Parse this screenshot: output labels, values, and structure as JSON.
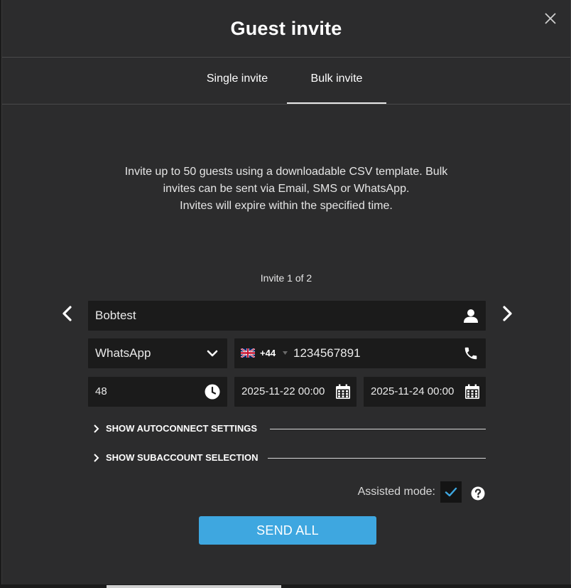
{
  "modal": {
    "title": "Guest invite",
    "close_icon": "close-icon"
  },
  "tabs": [
    {
      "label": "Single invite",
      "active": false
    },
    {
      "label": "Bulk invite",
      "active": true
    }
  ],
  "description": {
    "line1": "Invite up to 50 guests using a downloadable CSV template. Bulk",
    "line2": "invites can be sent via Email, SMS or WhatsApp.",
    "line3": "Invites will expire within the specified time."
  },
  "invite": {
    "counter": "Invite 1 of 2",
    "name": "Bobtest",
    "channel": "WhatsApp",
    "country_code": "+44",
    "phone": "1234567891",
    "expiry_hours": "48",
    "start": "2025-11-22 00:00",
    "end": "2025-11-24 00:00"
  },
  "sections": {
    "autoconnect": "SHOW AUTOCONNECT SETTINGS",
    "subaccount": "SHOW SUBACCOUNT SELECTION"
  },
  "assisted_mode": {
    "label": "Assisted mode:",
    "checked": true
  },
  "actions": {
    "send_all": "SEND ALL"
  },
  "colors": {
    "background": "#2c2c2d",
    "field": "#1b1b1b",
    "accent": "#3ea7e0",
    "checkmark": "#3ea7e0"
  }
}
